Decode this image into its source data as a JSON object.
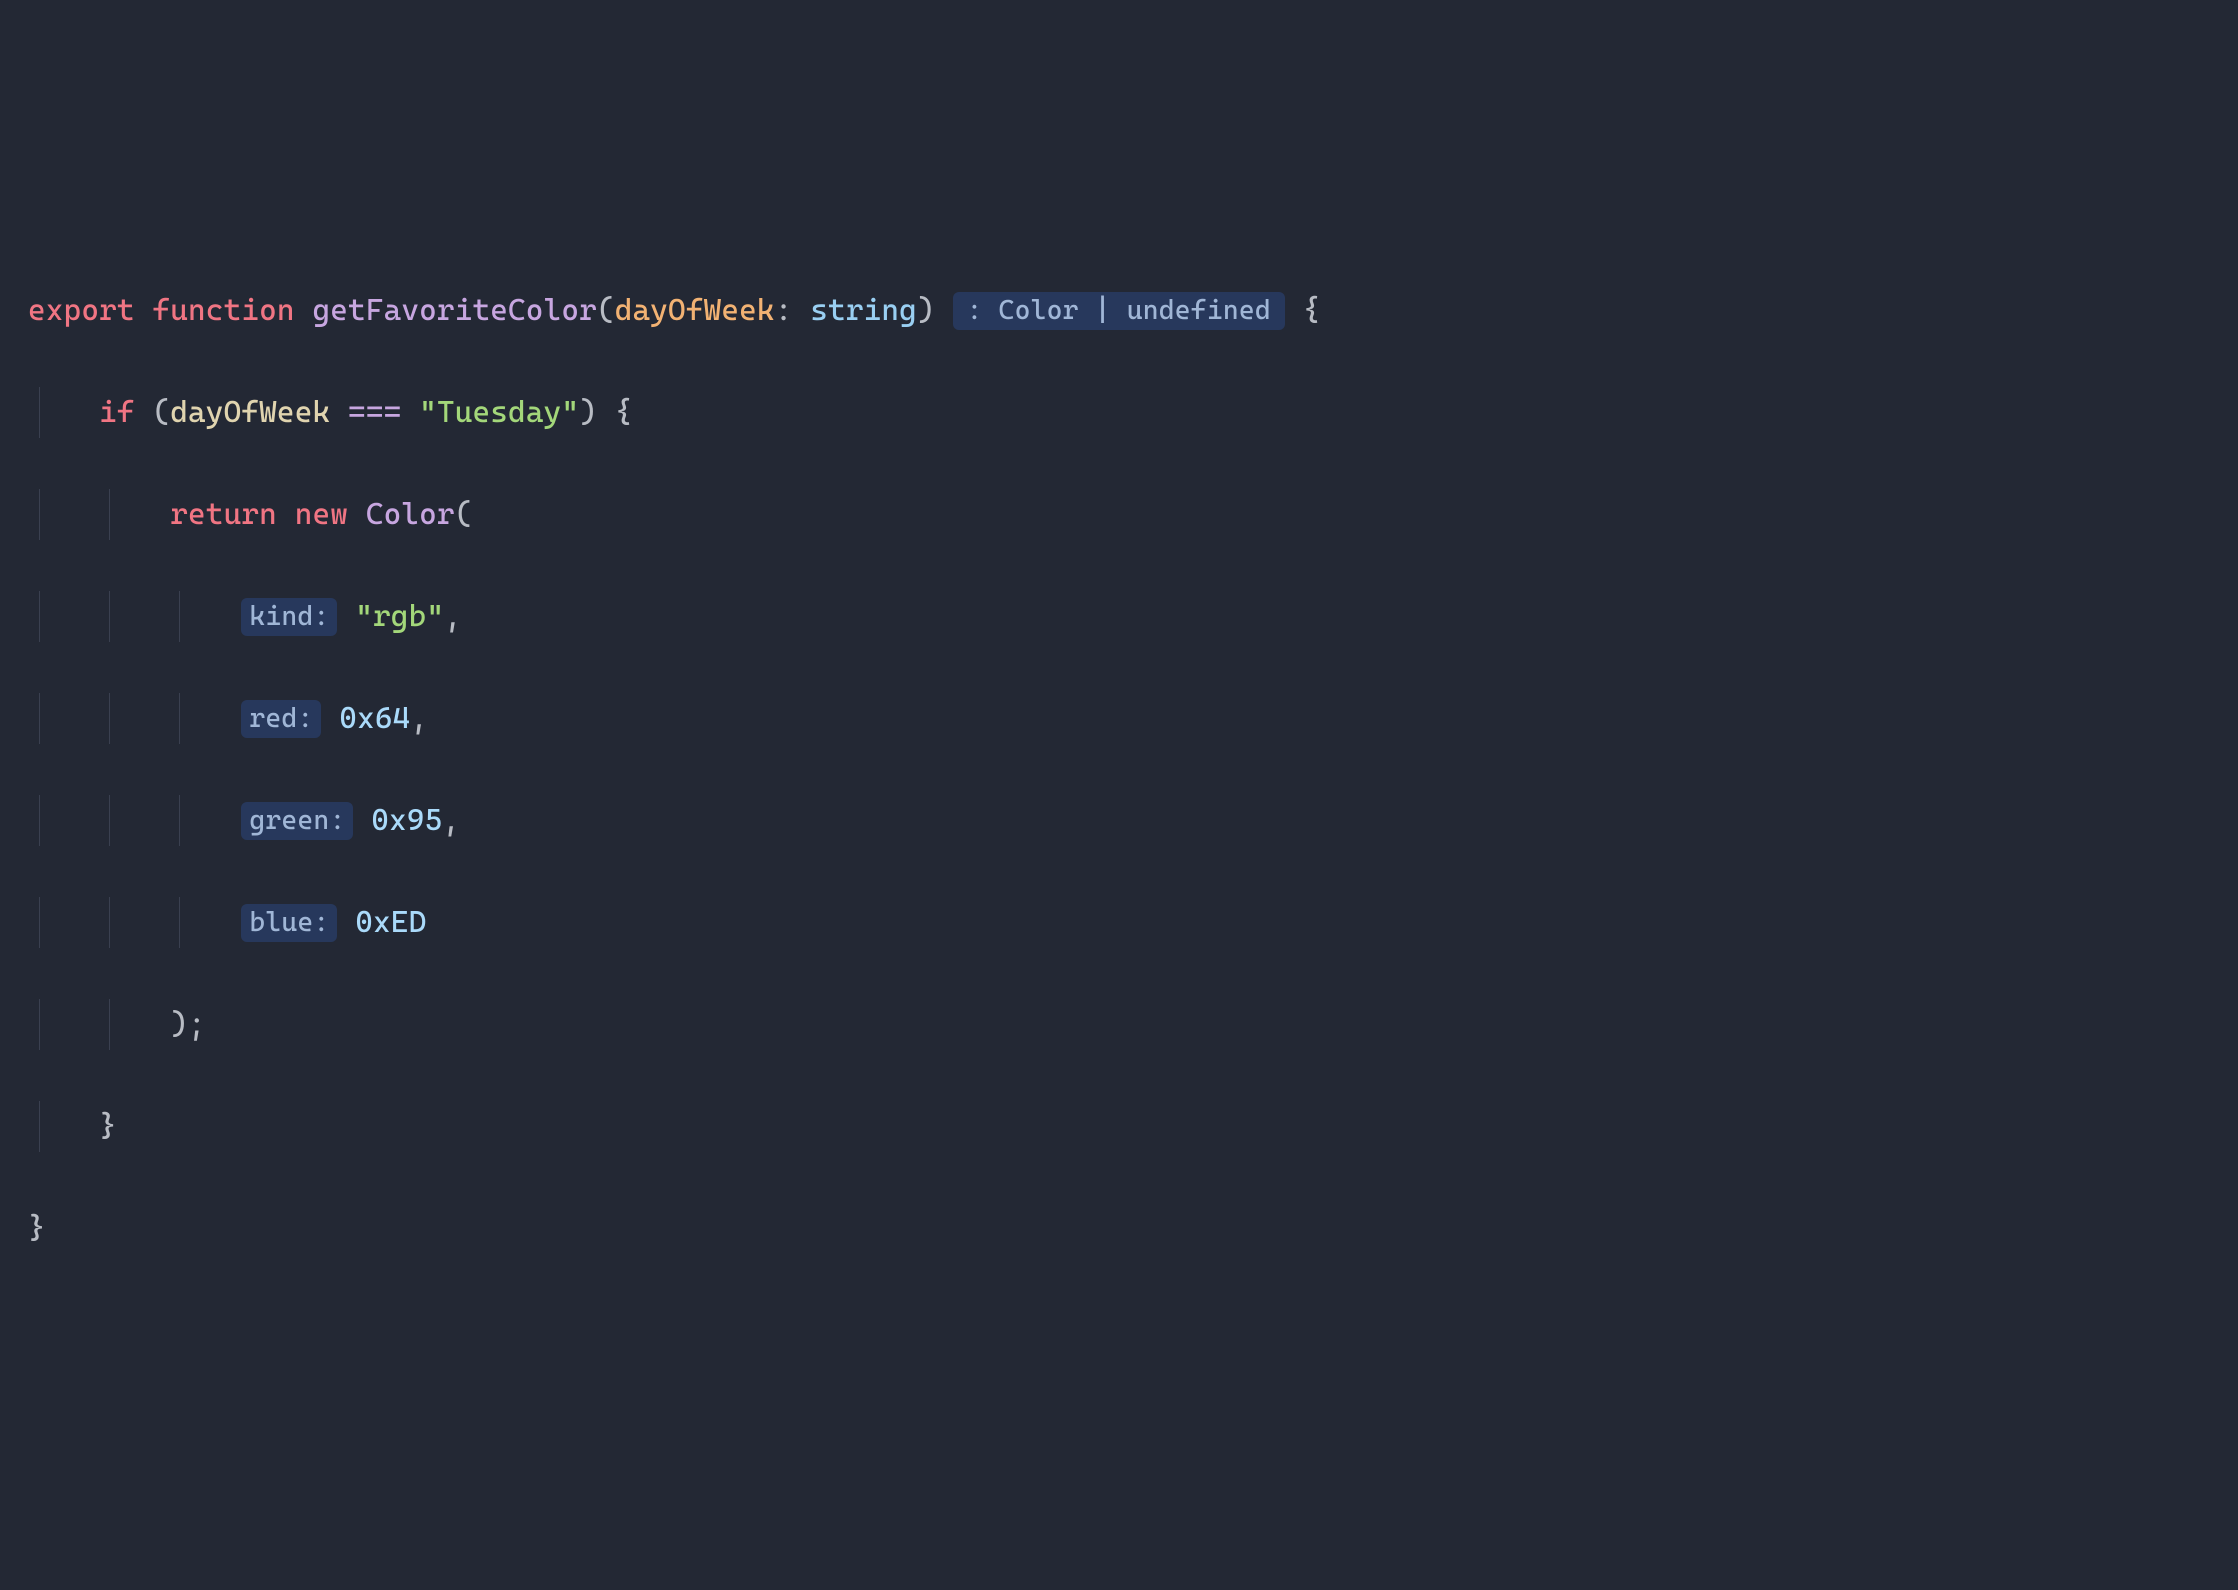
{
  "code": {
    "kw_export": "export",
    "kw_function": "function",
    "fn_name": "getFavoriteColor",
    "param_name": "dayOfWeek",
    "param_type": "string",
    "return_hint": ": Color | undefined",
    "kw_if": "if",
    "if_var": "dayOfWeek",
    "op_eq": "===",
    "str_tuesday": "\"Tuesday\"",
    "kw_return": "return",
    "kw_new": "new",
    "class_color": "Color",
    "hint_kind": "kind:",
    "val_kind": "\"rgb\"",
    "hint_red": "red:",
    "val_red": "0x64",
    "hint_green": "green:",
    "val_green": "0x95",
    "hint_blue": "blue:",
    "val_blue": "0xED"
  }
}
